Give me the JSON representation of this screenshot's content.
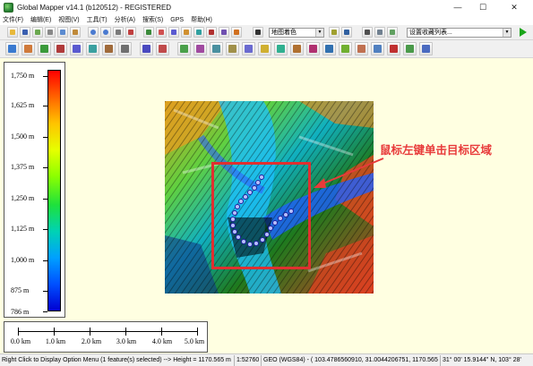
{
  "window": {
    "title": "Global Mapper v14.1 (b120512) - REGISTERED",
    "minimize": "—",
    "maximize": "☐",
    "close": "✕"
  },
  "menu": [
    "文件(F)",
    "编辑(E)",
    "视图(V)",
    "工具(T)",
    "分析(A)",
    "搜索(S)",
    "GPS",
    "帮助(H)"
  ],
  "toolbar": {
    "layer_combo": "地图着色",
    "list_combo": "设置收藏列表..."
  },
  "legend": {
    "labels": [
      "1,750 m",
      "1,625 m",
      "1,500 m",
      "1,375 m",
      "1,250 m",
      "1,125 m",
      "1,000 m",
      "875 m",
      "786 m"
    ],
    "max_m": 1750,
    "min_m": 786,
    "colors": [
      "#ff0000",
      "#ff6400",
      "#ffc400",
      "#e6ff00",
      "#8cff00",
      "#1ee13c",
      "#00d2b4",
      "#00a0ff",
      "#0050ff",
      "#0000d2"
    ]
  },
  "scale_bar": {
    "labels": [
      "0.0 km",
      "1.0 km",
      "2.0 km",
      "3.0 km",
      "4.0 km",
      "5.0 km"
    ]
  },
  "annotation": {
    "text": "鼠标左键单击目标区域",
    "color": "#e83a3a"
  },
  "status": {
    "hint": "Right Click to Display Option Menu (1 feature(s) selected) --> Height = 1170.565 m",
    "scale": "1:52760",
    "coords": "GEO (WGS84) - ( 103.4786560910, 31.0044206751, 1170.565 m )",
    "dms": "31° 00' 15.9144\" N, 103° 28'"
  }
}
